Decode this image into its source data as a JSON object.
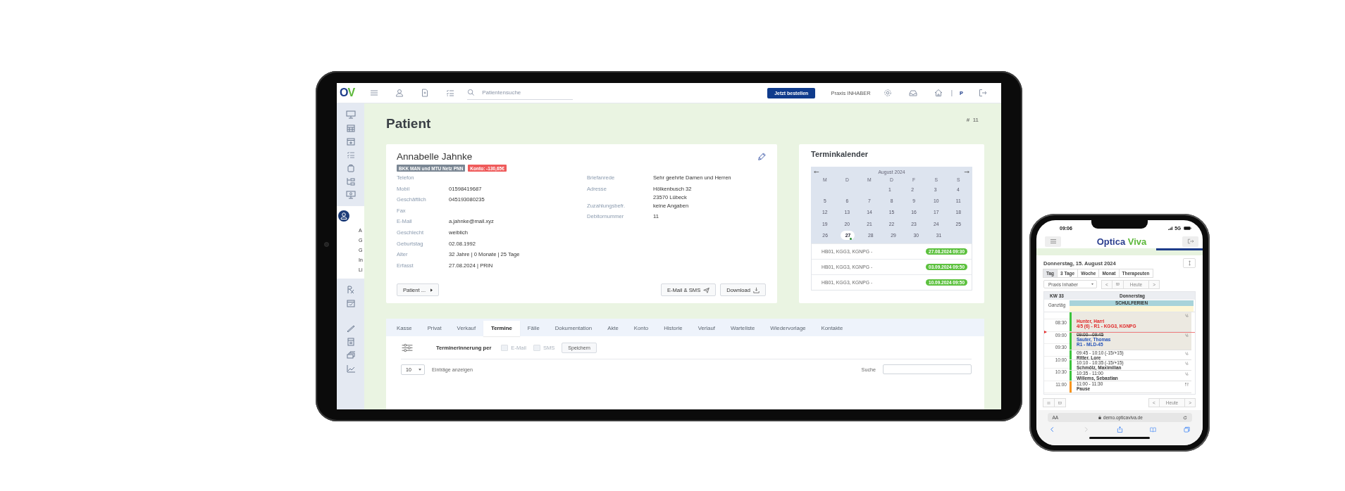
{
  "tablet": {
    "topbar": {
      "logo": {
        "first": "O",
        "second": "V"
      },
      "search": {
        "placeholder": "Patientensuche"
      },
      "order_button": "Jetzt bestellen",
      "practice": "Praxis INHABER",
      "user_initial": "P",
      "separator": "|"
    },
    "sidebar": {
      "submenu": [
        "A",
        "G",
        "G",
        "In",
        "Li"
      ]
    },
    "page": {
      "title": "Patient",
      "hash": "#",
      "number": "11"
    },
    "patient": {
      "name": "Annabelle Jahnke",
      "badges": [
        {
          "text": "BKK MAN und MTU Netz PNN",
          "color": "#7b8794"
        },
        {
          "text": "Konto: -130,65€",
          "color": "#ef5b5b"
        }
      ],
      "left_rows": [
        {
          "label": "Telefon"
        },
        {
          "label": "Mobil",
          "value": "01598419687"
        },
        {
          "label": "Geschäftlich",
          "value": "045193080235"
        },
        {
          "label": "Fax"
        },
        {
          "label": "E-Mail",
          "value": "a.jahnke@mail.xyz"
        },
        {
          "label": "Geschlecht",
          "value": "weiblich"
        },
        {
          "label": "Geburtstag",
          "value": "02.08.1992"
        },
        {
          "label": "Alter",
          "value": "32 Jahre | 0 Monate | 25 Tage"
        },
        {
          "label": "Erfasst",
          "value": "27.08.2024 | PRIN"
        }
      ],
      "right_rows": [
        {
          "label": "Briefanrede",
          "lines": [
            "Sehr geehrte Damen und Herren"
          ]
        },
        {
          "label": "Adresse",
          "lines": [
            "Hölkenbusch 32",
            "23570 Lübeck"
          ]
        },
        {
          "label": "Zuzahlungsbefr.",
          "lines": [
            "keine Angaben"
          ]
        },
        {
          "label": "Debitornummer",
          "lines": [
            "11"
          ]
        }
      ],
      "menu_button": "Patient ...",
      "buttons": [
        {
          "label": "E-Mail & SMS",
          "kind": "send"
        },
        {
          "label": "Download",
          "kind": "download"
        }
      ]
    },
    "calendar": {
      "title": "Terminkalender",
      "month": "August 2024",
      "weekdays": [
        "M",
        "D",
        "M",
        "D",
        "F",
        "S",
        "S"
      ],
      "weeks": [
        [
          {
            "label": "1",
            "selected": false,
            "marked": false
          },
          {
            "label": "2",
            "selected": false,
            "marked": false
          },
          {
            "label": "3",
            "selected": false,
            "marked": false
          },
          {
            "label": "4",
            "selected": false,
            "marked": false
          }
        ],
        [
          {
            "label": "5",
            "selected": false,
            "marked": false
          },
          {
            "label": "6",
            "selected": false,
            "marked": false
          },
          {
            "label": "7",
            "selected": false,
            "marked": false
          },
          {
            "label": "8",
            "selected": false,
            "marked": false
          },
          {
            "label": "9",
            "selected": false,
            "marked": false
          },
          {
            "label": "10",
            "selected": false,
            "marked": false
          },
          {
            "label": "11",
            "selected": false,
            "marked": false
          }
        ],
        [
          {
            "label": "12",
            "selected": false,
            "marked": false
          },
          {
            "label": "13",
            "selected": false,
            "marked": false
          },
          {
            "label": "14",
            "selected": false,
            "marked": false
          },
          {
            "label": "15",
            "selected": false,
            "marked": false
          },
          {
            "label": "16",
            "selected": false,
            "marked": false
          },
          {
            "label": "17",
            "selected": false,
            "marked": false
          },
          {
            "label": "18",
            "selected": false,
            "marked": false
          }
        ],
        [
          {
            "label": "19",
            "selected": false,
            "marked": false
          },
          {
            "label": "20",
            "selected": false,
            "marked": false
          },
          {
            "label": "21",
            "selected": false,
            "marked": false
          },
          {
            "label": "22",
            "selected": false,
            "marked": false
          },
          {
            "label": "23",
            "selected": false,
            "marked": false
          },
          {
            "label": "24",
            "selected": false,
            "marked": false
          },
          {
            "label": "25",
            "selected": false,
            "marked": false
          }
        ],
        [
          {
            "label": "26",
            "selected": false,
            "marked": false
          },
          {
            "label": "27",
            "selected": true,
            "marked": true
          },
          {
            "label": "28",
            "selected": false,
            "marked": false
          },
          {
            "label": "29",
            "selected": false,
            "marked": false
          },
          {
            "label": "30",
            "selected": false,
            "marked": false
          },
          {
            "label": "31",
            "selected": false,
            "marked": false
          }
        ]
      ],
      "appointments": [
        {
          "text": "HB01, KGG3, KGNPG -",
          "date": "27.08.2024 09:30"
        },
        {
          "text": "HB01, KGG3, KGNPG -",
          "date": "03.09.2024 09:50"
        },
        {
          "text": "HB01, KGG3, KGNPG -",
          "date": "10.09.2024 09:50"
        }
      ]
    },
    "tabs": [
      {
        "label": "Kasse",
        "selected": false
      },
      {
        "label": "Privat",
        "selected": false
      },
      {
        "label": "Verkauf",
        "selected": false
      },
      {
        "label": "Termine",
        "selected": true
      },
      {
        "label": "Fälle",
        "selected": false
      },
      {
        "label": "Dokumentation",
        "selected": false
      },
      {
        "label": "Akte",
        "selected": false
      },
      {
        "label": "Konto",
        "selected": false
      },
      {
        "label": "Historie",
        "selected": false
      },
      {
        "label": "Verlauf",
        "selected": false
      },
      {
        "label": "Warteliste",
        "selected": false
      },
      {
        "label": "Wiedervorlage",
        "selected": false
      },
      {
        "label": "Kontakte",
        "selected": false
      }
    ],
    "reminder": {
      "label": "Terminerinnerung per",
      "options": [
        {
          "label": "E-Mail",
          "checked": false
        },
        {
          "label": "SMS",
          "checked": false
        }
      ],
      "save": "Speichern"
    },
    "entries": {
      "value": "10",
      "label": "Einträge anzeigen",
      "search_label": "Suche"
    }
  },
  "phone": {
    "time": "09:06",
    "network": "5G",
    "logo": {
      "first": "Optica",
      "second": "Viva"
    },
    "date": "Donnerstag, 15. August 2024",
    "views": [
      {
        "label": "Tag",
        "selected": true
      },
      {
        "label": "3 Tage",
        "selected": false
      },
      {
        "label": "Woche",
        "selected": false
      },
      {
        "label": "Monat",
        "selected": false
      },
      {
        "label": "Therapeuten",
        "selected": false
      }
    ],
    "practice_select": "Praxis Inhaber",
    "nav": {
      "prev": "<",
      "today": "Heute",
      "next": ">"
    },
    "week": "KW 33",
    "day": "Donnerstag",
    "all_day": "Ganztäg",
    "holiday": "SCHULFERIEN",
    "times": [
      "08:30",
      "09:00",
      "09:30",
      "10:00",
      "10:30",
      "11:00"
    ],
    "events": [
      {
        "name": "Hunter, Harri",
        "detail": "4/5 (6) - R1 - KGG3, KGNPG",
        "kind": "warning",
        "color": "#3cc43c"
      },
      {
        "time": "09:00 - 09:45",
        "name": "Sauter, Thomas",
        "detail": "R1 - MLD-45",
        "kind": "cancelled",
        "color": "#3cc43c"
      },
      {
        "time": "09:45 - 10:10  (-15/+15)",
        "name": "Ritter, Lore",
        "kind": "normal",
        "color": "#3cc43c"
      },
      {
        "time": "10:10 - 10:35  (-15/+15)",
        "name": "Schmölz, Maximilian",
        "kind": "normal",
        "color": "#3cc43c"
      },
      {
        "time": "10:35 - 11:00",
        "name": "Willems, Sebastian",
        "kind": "normal",
        "color": "#3cc43c"
      },
      {
        "time": "11:00 - 11:30",
        "name": "Pause",
        "kind": "break",
        "color": "#f7941d"
      }
    ],
    "bottom_nav": {
      "prev": "<",
      "today": "Heute",
      "next": ">"
    },
    "browser": {
      "text_size": "AA",
      "url": "demo.opticaviva.de"
    }
  }
}
